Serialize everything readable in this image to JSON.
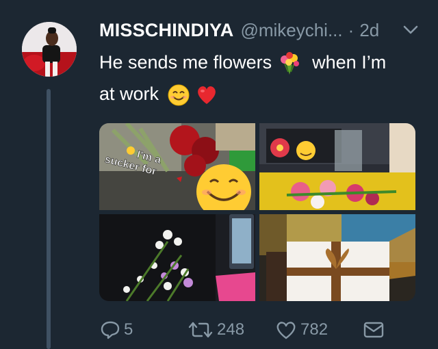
{
  "tweet": {
    "author_name": "MISSCHINDIYA",
    "handle": "@mikeychi...",
    "separator": "·",
    "time": "2d",
    "text_part1": "He sends me flowers",
    "text_part2": "when I’m",
    "text_part3": "at work",
    "emoji_1": "bouquet-emoji",
    "emoji_2": "smiling-face-emoji",
    "emoji_3": "red-heart-emoji"
  },
  "media": {
    "caption": [
      "I'm a",
      "sucker for"
    ],
    "images": [
      "roses-photo",
      "flowers-on-desk-photo",
      "white-flowers-photo",
      "chocolate-gift-box-photo"
    ]
  },
  "actions": {
    "reply_count": "5",
    "retweet_count": "248",
    "like_count": "782"
  },
  "colors": {
    "background": "#1c2732",
    "secondary_text": "#8899a6",
    "thread_line": "#3f5163"
  }
}
